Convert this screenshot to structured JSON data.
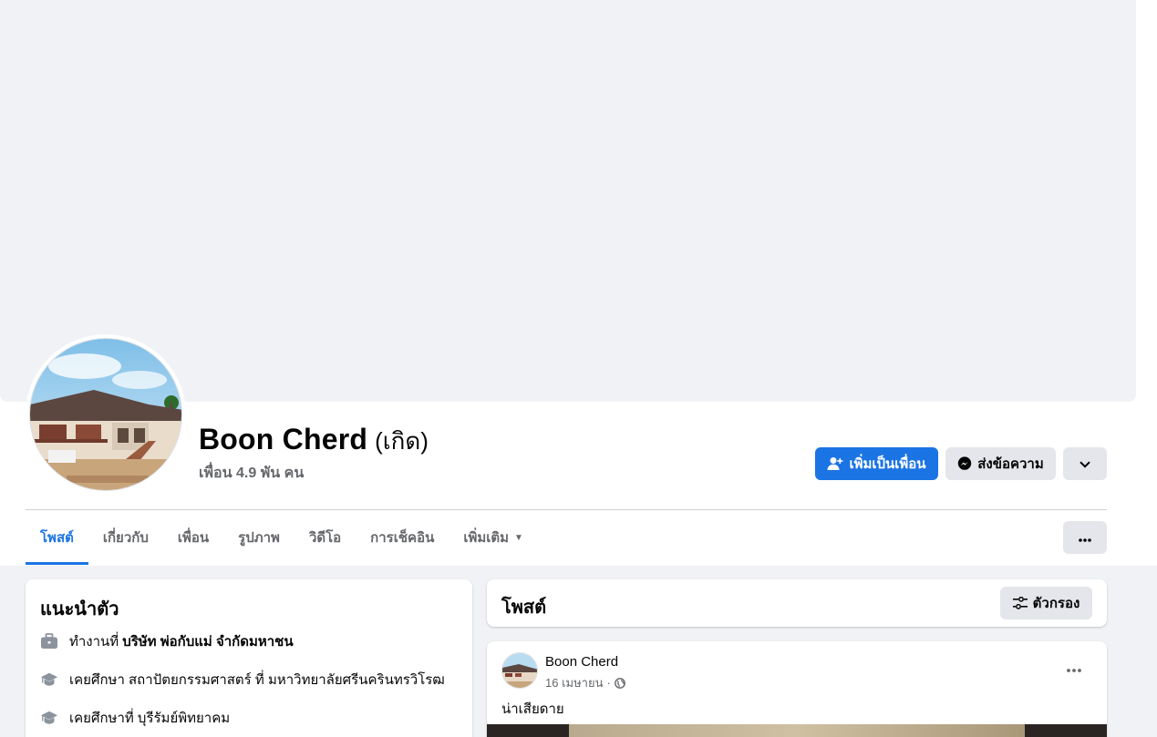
{
  "profile": {
    "name": "Boon Cherd",
    "alt_name": "(เกิด)",
    "friends_count": "เพื่อน 4.9 พัน คน"
  },
  "actions": {
    "add_friend": "เพิ่มเป็นเพื่อน",
    "message": "ส่งข้อความ"
  },
  "tabs": [
    {
      "label": "โพสต์",
      "active": true
    },
    {
      "label": "เกี่ยวกับ"
    },
    {
      "label": "เพื่อน"
    },
    {
      "label": "รูปภาพ"
    },
    {
      "label": "วิดีโอ"
    },
    {
      "label": "การเช็คอิน"
    },
    {
      "label": "เพิ่มเติม"
    }
  ],
  "intro": {
    "title": "แนะนำตัว",
    "items": [
      {
        "icon": "briefcase-icon",
        "prefix": "ทำงานที่",
        "bold": "บริษัท พ่อกับแม่ จำกัดมหาชน"
      },
      {
        "icon": "graduation-cap-icon",
        "prefix": "เคยศึกษา สถาปัตยกรรมศาสตร์ ที่ มหาวิทยาลัยศรีนครินทรวิโรฒ",
        "bold": ""
      },
      {
        "icon": "graduation-cap-icon",
        "prefix": "เคยศึกษาที่ บุรีรัมย์พิทยาคม",
        "bold": ""
      }
    ]
  },
  "posts": {
    "title": "โพสต์",
    "filter_label": "ตัวกรอง",
    "items": [
      {
        "author": "Boon Cherd",
        "date": "16 เมษายน",
        "separator": "·",
        "privacy_icon": "globe-icon",
        "text": "น่าเสียดาย"
      }
    ]
  },
  "colors": {
    "accent": "#1b74e4",
    "background": "#f0f2f5",
    "secondary_text": "#65676b",
    "button_grey": "#e4e6eb"
  }
}
